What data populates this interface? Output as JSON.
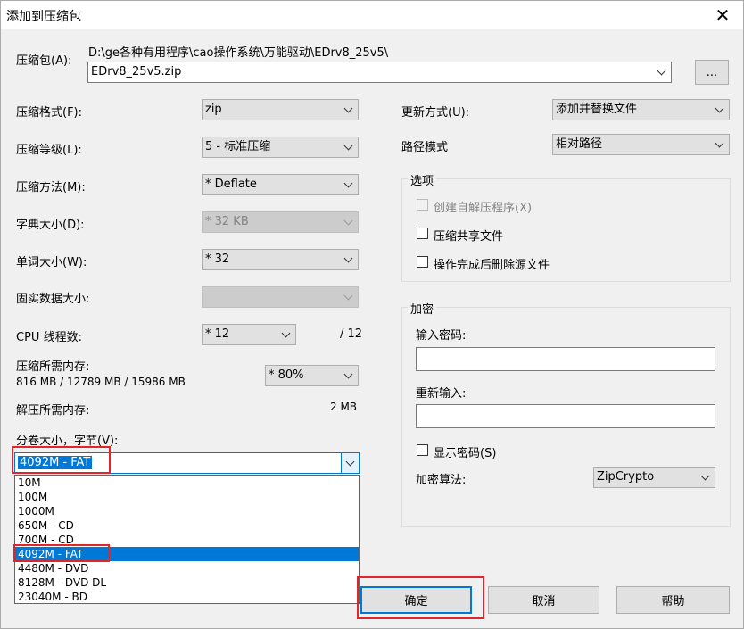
{
  "window": {
    "title": "添加到压缩包",
    "close_symbol": "✕"
  },
  "archive": {
    "label": "压缩包(A):",
    "path": "D:\\ge各种有用程序\\cao操作系统\\万能驱动\\EDrv8_25v5\\",
    "filename": "EDrv8_25v5.zip",
    "browse_label": "..."
  },
  "left": {
    "format_label": "压缩格式(F):",
    "format_value": "zip",
    "level_label": "压缩等级(L):",
    "level_value": "5 - 标准压缩",
    "method_label": "压缩方法(M):",
    "method_value": "* Deflate",
    "dict_label": "字典大小(D):",
    "dict_value": "* 32 KB",
    "word_label": "单词大小(W):",
    "word_value": "* 32",
    "solid_label": "固实数据大小:",
    "solid_value": "",
    "cpu_label": "CPU 线程数:",
    "cpu_value": "* 12",
    "cpu_total": "/ 12",
    "mem_label": "压缩所需内存:",
    "mem_value": "816 MB / 12789 MB / 15986 MB",
    "mem_percent": "* 80%",
    "decomp_label": "解压所需内存:",
    "decomp_value": "2 MB",
    "split_label": "分卷大小，字节(V):",
    "split_value": "4092M - FAT"
  },
  "split_options": [
    "10M",
    "100M",
    "1000M",
    "650M - CD",
    "700M - CD",
    "4092M - FAT",
    "4480M - DVD",
    "8128M - DVD DL",
    "23040M - BD"
  ],
  "split_selected_index": 5,
  "right": {
    "update_label": "更新方式(U):",
    "update_value": "添加并替换文件",
    "pathmode_label": "路径模式",
    "pathmode_value": "相对路径",
    "options_title": "选项",
    "opt_sfx": "创建自解压程序(X)",
    "opt_shared": "压缩共享文件",
    "opt_delete": "操作完成后删除源文件",
    "encrypt_title": "加密",
    "password_label": "输入密码:",
    "reenter_label": "重新输入:",
    "show_password": "显示密码(S)",
    "algo_label": "加密算法:",
    "algo_value": "ZipCrypto"
  },
  "buttons": {
    "ok": "确定",
    "cancel": "取消",
    "help": "帮助"
  },
  "colors": {
    "selection": "#0078d7",
    "highlight": "#e0262a"
  }
}
